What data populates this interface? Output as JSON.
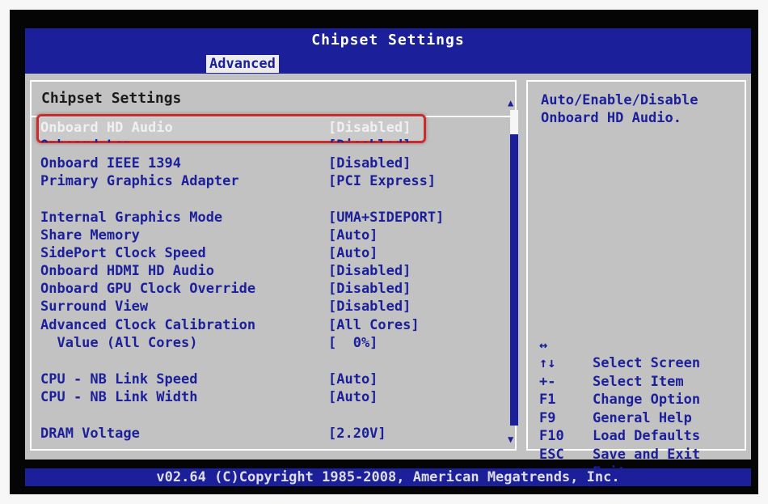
{
  "header": {
    "title": "Chipset Settings",
    "active_tab": "Advanced"
  },
  "section_title": "Chipset Settings",
  "settings": [
    {
      "label": "Onboard HD Audio",
      "value": "[Disabled]"
    },
    {
      "label": "Onboard Lan",
      "value": "[Disabled]"
    },
    {
      "label": "Onboard IEEE 1394",
      "value": "[Disabled]"
    },
    {
      "label": "Primary Graphics Adapter",
      "value": "[PCI Express]"
    },
    {
      "label": "Internal Graphics Mode",
      "value": "[UMA+SIDEPORT]"
    },
    {
      "label": "Share Memory",
      "value": "[Auto]"
    },
    {
      "label": "SidePort Clock Speed",
      "value": "[Auto]"
    },
    {
      "label": "Onboard HDMI HD Audio",
      "value": "[Disabled]"
    },
    {
      "label": "Onboard GPU Clock Override",
      "value": "[Disabled]"
    },
    {
      "label": "Surround View",
      "value": "[Disabled]"
    },
    {
      "label": "Advanced Clock Calibration",
      "value": "[All Cores]"
    },
    {
      "label": "  Value (All Cores)",
      "value": "[  0%]"
    },
    {
      "label": "CPU - NB Link Speed",
      "value": "[Auto]"
    },
    {
      "label": "CPU - NB Link Width",
      "value": "[Auto]"
    },
    {
      "label": "DRAM Voltage",
      "value": "[2.20V]"
    }
  ],
  "help": {
    "text": "Auto/Enable/Disable Onboard HD Audio."
  },
  "keys": [
    {
      "key": "↔",
      "desc": "Select Screen"
    },
    {
      "key": "↑↓",
      "desc": "Select Item"
    },
    {
      "key": "+-",
      "desc": "Change Option"
    },
    {
      "key": "F1",
      "desc": "General Help"
    },
    {
      "key": "F9",
      "desc": "Load Defaults"
    },
    {
      "key": "F10",
      "desc": "Save and Exit"
    },
    {
      "key": "ESC",
      "desc": "Exit"
    }
  ],
  "footer": {
    "text": "v02.64 (C)Copyright 1985-2008, American Megatrends, Inc."
  },
  "scroll": {
    "up_icon": "▲",
    "down_icon": "▼"
  },
  "colors": {
    "bios_blue": "#1c1f9a",
    "panel_gray": "#c2c2c2",
    "highlight_red": "#cc2b2b"
  }
}
